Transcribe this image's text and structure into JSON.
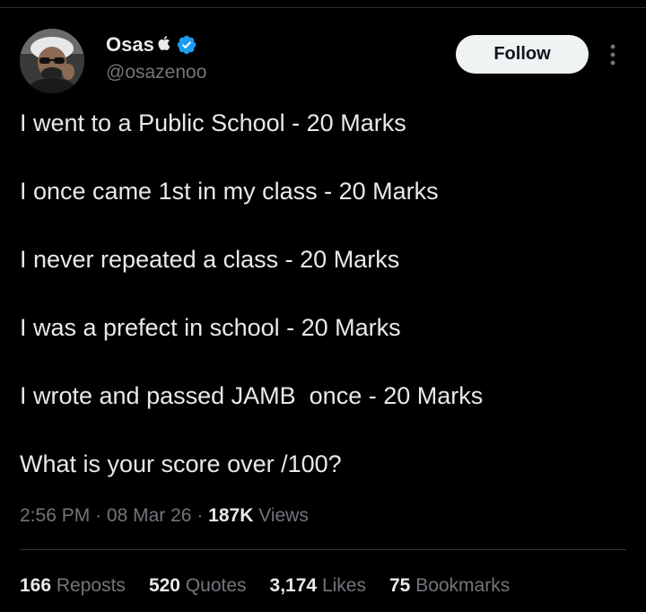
{
  "author": {
    "display_name": "Osas",
    "name_glyph": "",
    "handle": "@osazenoo",
    "verified": true
  },
  "actions": {
    "follow_label": "Follow",
    "more_icon": "more-vertical-icon"
  },
  "tweet": {
    "lines": [
      "I went to a Public School - 20 Marks",
      "I once came 1st in my class - 20 Marks",
      "I never repeated a class - 20 Marks",
      "I was a prefect in school - 20 Marks",
      "I wrote and passed JAMB  once - 20 Marks",
      "What is your score over /100?"
    ]
  },
  "meta": {
    "time": "2:56 PM",
    "date": "08 Mar 26",
    "separator": "·",
    "views_count": "187K",
    "views_label": "Views"
  },
  "stats": [
    {
      "count": "166",
      "label": "Reposts"
    },
    {
      "count": "520",
      "label": "Quotes"
    },
    {
      "count": "3,174",
      "label": "Likes"
    },
    {
      "count": "75",
      "label": "Bookmarks"
    }
  ],
  "colors": {
    "background": "#000000",
    "text_primary": "#e7e9ea",
    "text_secondary": "#71767b",
    "verified_blue": "#1d9bf0",
    "button_bg": "#eff3f4",
    "divider": "#2f3336"
  }
}
